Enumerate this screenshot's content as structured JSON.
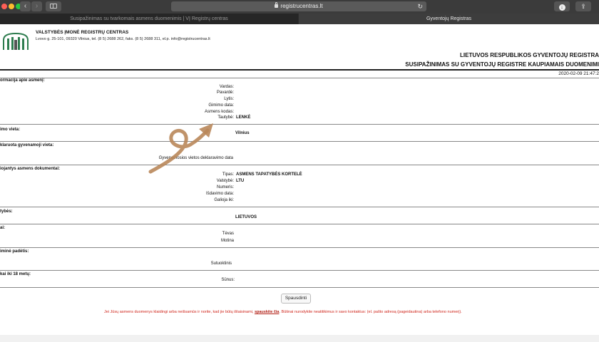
{
  "browser": {
    "url": "registrucentras.lt",
    "tabs": [
      {
        "label": "Susipažinimas su tvarkomais asmens duomenimis | VĮ Registrų centras",
        "active": false
      },
      {
        "label": "Gyventojų Registras",
        "active": true
      }
    ]
  },
  "header": {
    "org_name": "VALSTYBĖS ĮMONĖ REGISTRŲ CENTRAS",
    "org_contacts": "Lvovo g. 25-101, 09320 Vilnius, tel. (8 5) 2688 262, faks. (8 5) 2688 311, el.p. info@registrucentras.lt",
    "title_1": "LIETUVOS RESPUBLIKOS GYVENTOJŲ REGISTRA",
    "title_2": "SUSIPAŽINIMAS SU GYVENTOJŲ REGISTRE KAUPIAMAIS DUOMENIMI",
    "timestamp": "2020-02-09 21:47:2"
  },
  "sections": {
    "info": {
      "heading": "ormacija apie asmenį:",
      "fields": [
        {
          "label": "Vardas:",
          "value": ""
        },
        {
          "label": "Pavardė:",
          "value": ""
        },
        {
          "label": "Lytis:",
          "value": ""
        },
        {
          "label": "Gimimo data:",
          "value": ""
        },
        {
          "label": "Asmens kodas:",
          "value": ""
        },
        {
          "label": "Tautybė:",
          "value": "LENKĖ"
        }
      ]
    },
    "birthplace": {
      "heading": "imo vieta:",
      "value": "Vilnius"
    },
    "declared": {
      "heading": "klaruota gyvenamoji vieta:",
      "label": "Gyvenamosios vietos deklaravimo data"
    },
    "documents": {
      "heading": "iojantys asmens dokumentai:",
      "fields": [
        {
          "label": "Tipas:",
          "value": "ASMENS TAPATYBĖS KORTELĖ"
        },
        {
          "label": "Valstybė:",
          "value": "LTU"
        },
        {
          "label": "Numeris:",
          "value": ""
        },
        {
          "label": "Išdavimo data:",
          "value": ""
        },
        {
          "label": "Galioja iki:",
          "value": ""
        }
      ]
    },
    "citizenship": {
      "heading": "tybės:",
      "value": "LIETUVOS"
    },
    "parents": {
      "heading": "ai:",
      "fields": [
        {
          "label": "Tėvas"
        },
        {
          "label": "Motina"
        }
      ]
    },
    "marital": {
      "heading": "iminė padėtis:",
      "label": "Sutuoktinis"
    },
    "children": {
      "heading": "kai iki 18 metų:",
      "label": "Sūnus:"
    }
  },
  "actions": {
    "print_label": "Spausdinti"
  },
  "footer": {
    "note_before": "Jei Jūsų asmens duomenys klaidingi arba neišsamūs ir norite, kad jie būtų ištaisinami, ",
    "note_link": "spauskite čia",
    "note_after": ". Būtinai nurodykite neatitikimus ir savo kontaktus: (el. pašto adresą (pageidautina) arba telefono numerį)."
  },
  "colors": {
    "chrome": "#3b3b3b",
    "annotation_arrow": "#b9875a",
    "warning_text": "#d0281e"
  },
  "icons": [
    "lock-icon",
    "reload-icon",
    "back-icon",
    "forward-icon",
    "sidebar-icon",
    "download-icon",
    "share-icon",
    "registry-logo",
    "curly-arrow"
  ]
}
